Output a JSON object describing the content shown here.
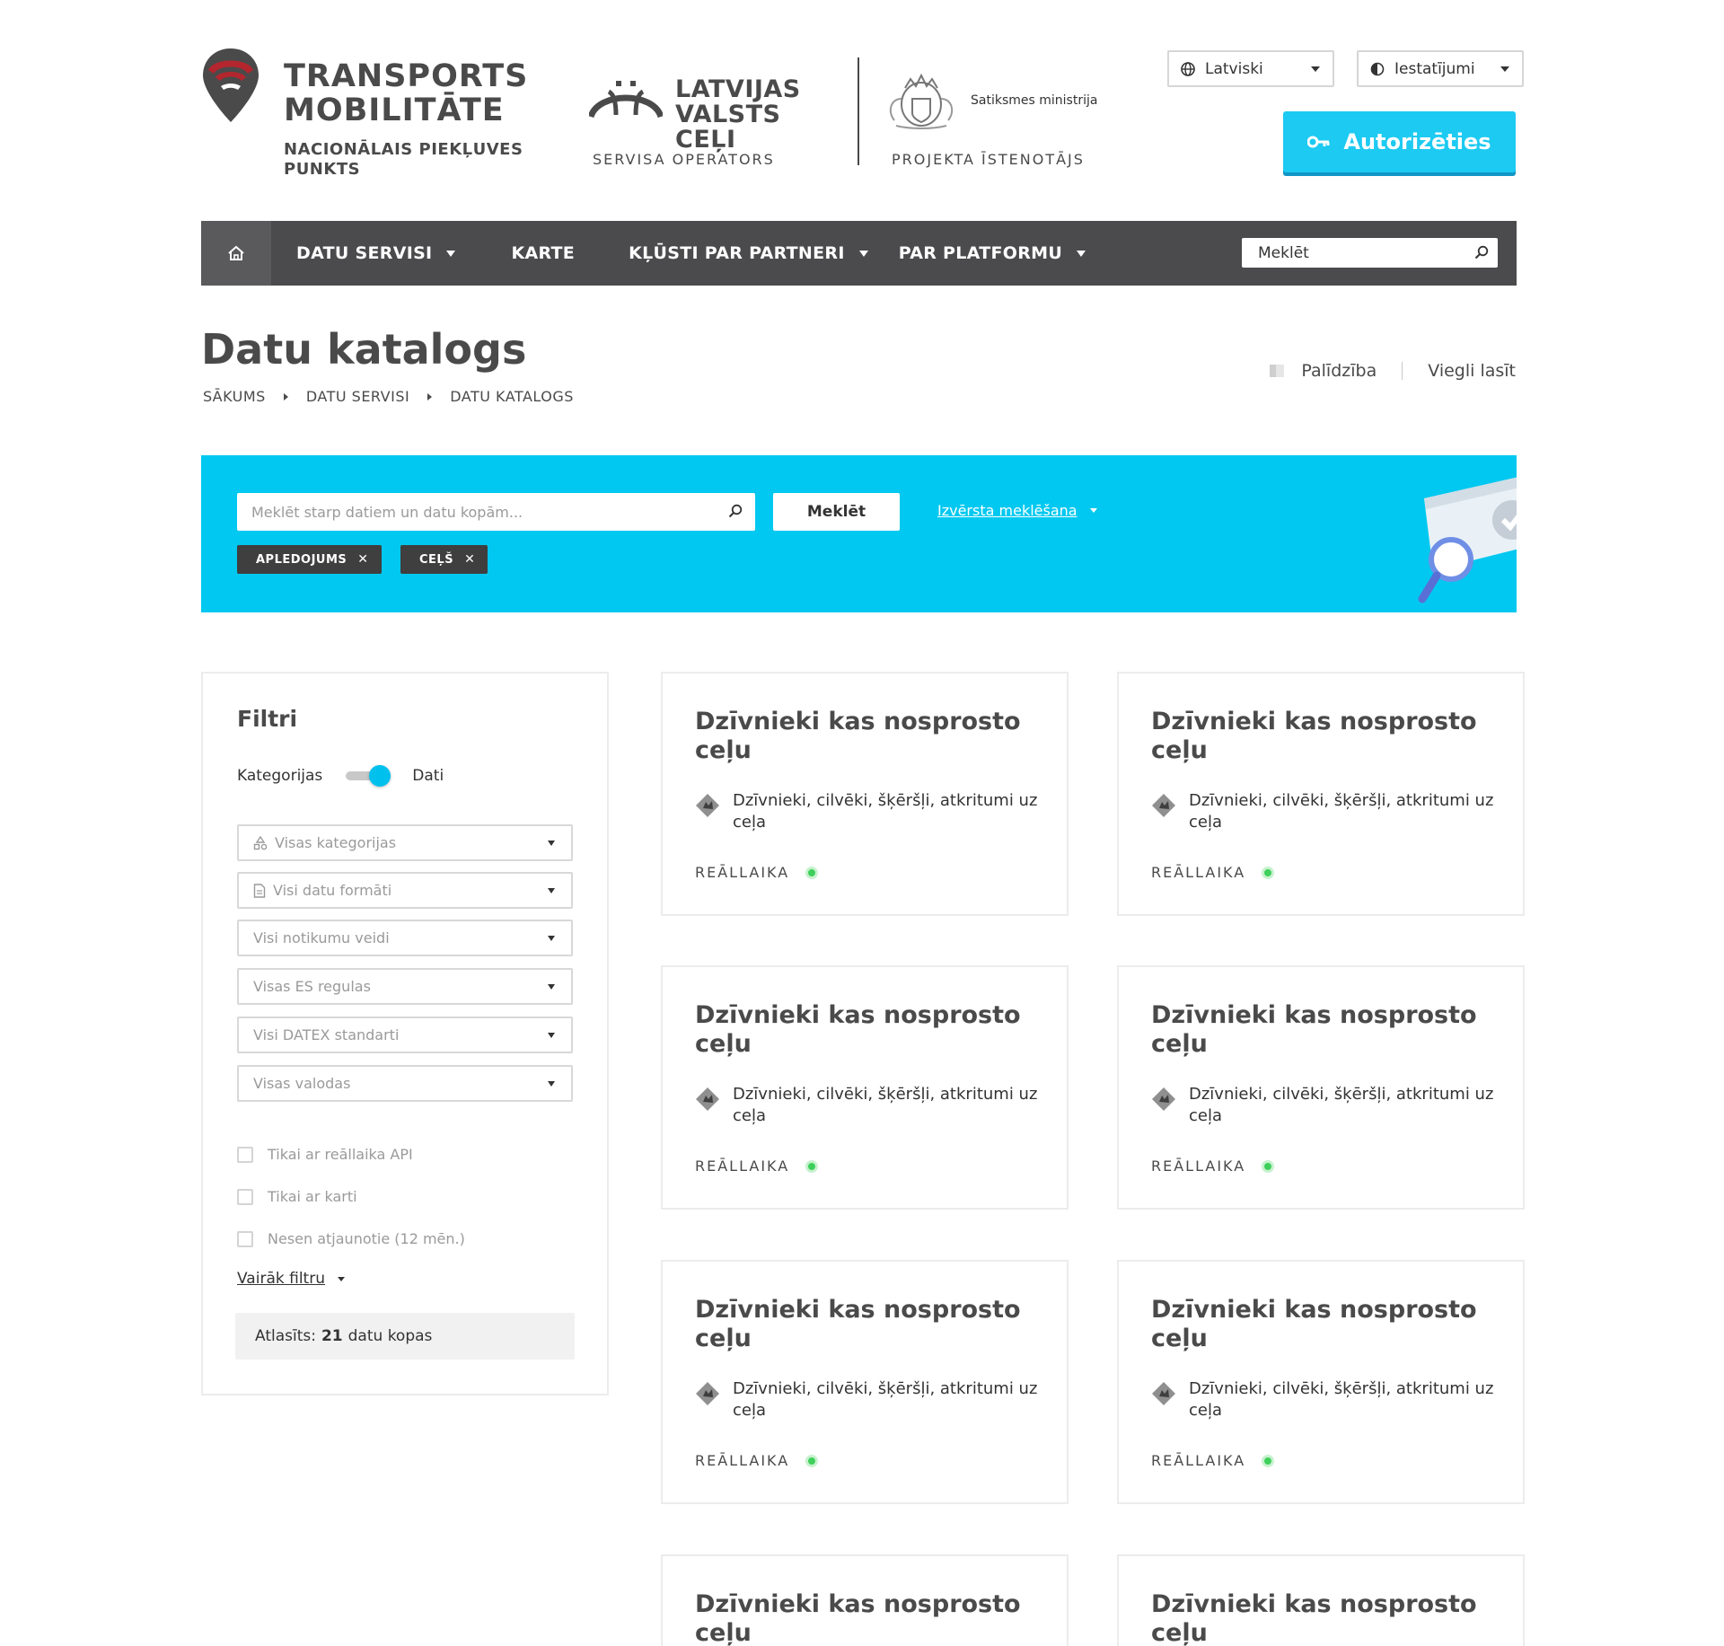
{
  "header": {
    "brand_line1": "TRANSPORTS",
    "brand_line2": "MOBILITĀTE",
    "brand_sub1": "NACIONĀLAIS PIEKĻUVES",
    "brand_sub2": "PUNKTS",
    "operator_name1": "LATVIJAS",
    "operator_name2": "VALSTS CEĻI",
    "operator_role": "SERVISA OPERATORS",
    "ministry_name": "Satiksmes ministrija",
    "ministry_role": "PROJEKTA ĪSTENOTĀJS",
    "language_label": "Latviski",
    "settings_label": "Iestatījumi",
    "login_label": "Autorizēties"
  },
  "nav": {
    "items": [
      {
        "label": "DATU SERVISI"
      },
      {
        "label": "KARTE"
      },
      {
        "label": "KĻŪSTI PAR PARTNERI"
      },
      {
        "label": "PAR PLATFORMU"
      }
    ],
    "search_placeholder": "Meklēt"
  },
  "page": {
    "title": "Datu katalogs",
    "breadcrumb": [
      "SĀKUMS",
      "DATU SERVISI",
      "DATU KATALOGS"
    ],
    "help_label": "Palīdzība",
    "easy_read_label": "Viegli lasīt"
  },
  "search": {
    "placeholder": "Meklēt starp datiem un datu kopām...",
    "button_label": "Meklēt",
    "advanced_label": "Izvērsta meklēšana",
    "tags": [
      "APLEDOJUMS",
      "CEĻŠ"
    ]
  },
  "filters": {
    "title": "Filtri",
    "toggle_left": "Kategorijas",
    "toggle_right": "Dati",
    "selects": [
      "Visas kategorijas",
      "Visi datu formāti",
      "Visi notikumu veidi",
      "Visas ES regulas",
      "Visi DATEX standarti",
      "Visas valodas"
    ],
    "checkboxes": [
      "Tikai ar reāllaika API",
      "Tikai ar karti",
      "Nesen atjaunotie (12 mēn.)"
    ],
    "more_label": "Vairāk filtru",
    "selected_prefix": "Atlasīts:",
    "selected_count": "21",
    "selected_suffix": "datu kopas"
  },
  "cards": [
    {
      "title": "Dzīvnieki kas nosprosto ceļu",
      "description": "Dzīvnieki, cilvēki, šķēršļi, atkritumi uz ceļa",
      "status": "REĀLLAIKA"
    },
    {
      "title": "Dzīvnieki kas nosprosto ceļu",
      "description": "Dzīvnieki, cilvēki, šķēršļi, atkritumi uz ceļa",
      "status": "REĀLLAIKA"
    },
    {
      "title": "Dzīvnieki kas nosprosto ceļu",
      "description": "Dzīvnieki, cilvēki, šķēršļi, atkritumi uz ceļa",
      "status": "REĀLLAIKA"
    },
    {
      "title": "Dzīvnieki kas nosprosto ceļu",
      "description": "Dzīvnieki, cilvēki, šķēršļi, atkritumi uz ceļa",
      "status": "REĀLLAIKA"
    },
    {
      "title": "Dzīvnieki kas nosprosto ceļu",
      "description": "Dzīvnieki, cilvēki, šķēršļi, atkritumi uz ceļa",
      "status": "REĀLLAIKA"
    },
    {
      "title": "Dzīvnieki kas nosprosto ceļu",
      "description": "Dzīvnieki, cilvēki, šķēršļi, atkritumi uz ceļa",
      "status": "REĀLLAIKA"
    },
    {
      "title": "Dzīvnieki kas nosprosto ceļu",
      "description": "",
      "status": ""
    },
    {
      "title": "Dzīvnieki kas nosprosto ceļu",
      "description": "",
      "status": ""
    }
  ],
  "colors": {
    "accent": "#00c8f0",
    "brand_red": "#b3262e",
    "nav_bg": "#4b4b4d",
    "status_green": "#3fd05b"
  }
}
